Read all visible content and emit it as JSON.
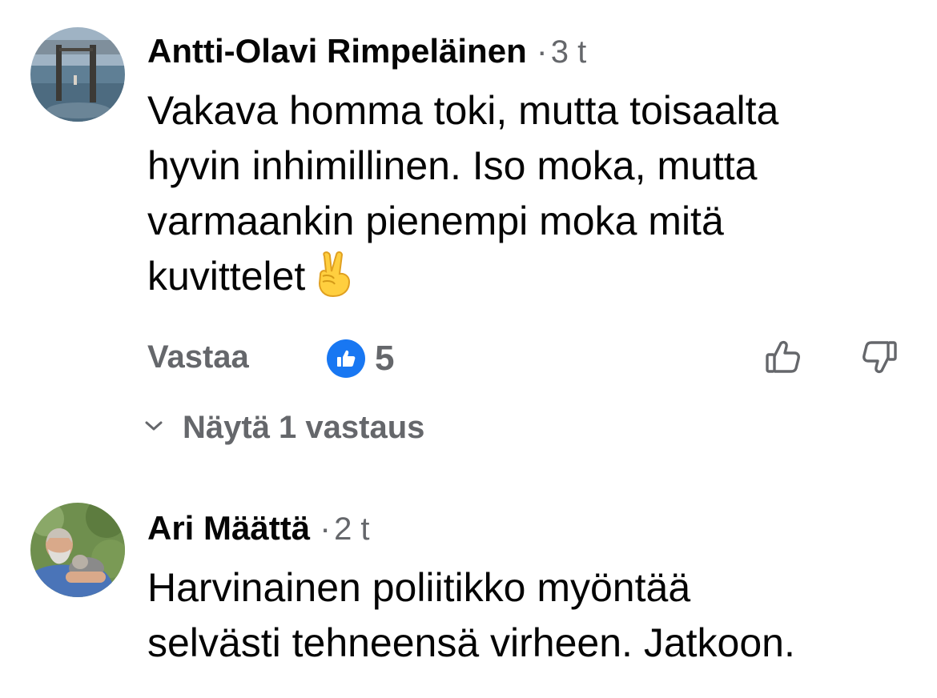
{
  "comments": [
    {
      "author": "Antti-Olavi Rimpeläinen",
      "separator": "·",
      "time": "3 t",
      "text": "Vakava homma toki, mutta toisaalta\nhyvin inhimillinen. Iso moka, mutta\nvarmaankin pienempi moka mitä\nkuvittelet",
      "emoji": "victory-hand-emoji",
      "actions": {
        "reply_label": "Vastaa",
        "reaction_icon": "like-icon",
        "reaction_count": "5"
      },
      "show_replies_label": "Näytä 1 vastaus"
    },
    {
      "author": "Ari Määttä",
      "separator": "·",
      "time": "2 t",
      "text": "Harvinainen poliitikko myöntää\nselvästi tehneensä virheen. Jatkoon."
    }
  ],
  "icons": {
    "upvote": "thumbs-up-outline-icon",
    "downvote": "thumbs-down-outline-icon",
    "expand": "chevron-down-icon"
  },
  "colors": {
    "text": "#050505",
    "secondary": "#65676b",
    "like_blue": "#1877f2"
  }
}
